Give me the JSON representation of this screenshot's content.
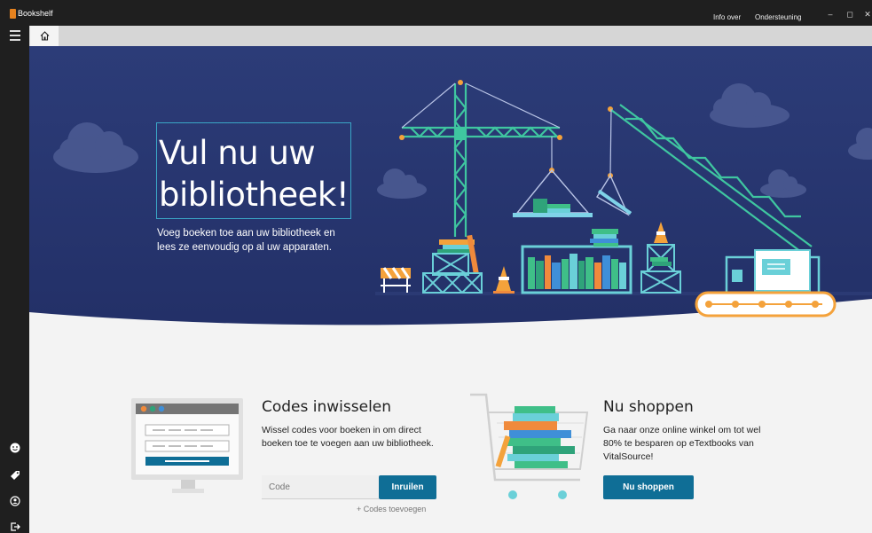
{
  "titlebar": {
    "app_title": "Bookshelf",
    "about": "Info over",
    "support": "Ondersteuning",
    "minimize": "–",
    "maximize": "◻",
    "close": "✕"
  },
  "hero": {
    "title_line1": "Vul nu uw",
    "title_line2": "bibliotheek!",
    "subtitle": "Voeg boeken toe aan uw bibliotheek en lees ze eenvoudig op al uw apparaten."
  },
  "redeem": {
    "title": "Codes inwisselen",
    "text": "Wissel codes voor boeken in om direct boeken toe te voegen aan uw bibliotheek.",
    "input_placeholder": "Code",
    "button": "Inruilen",
    "add_codes": "+ Codes toevoegen"
  },
  "shop": {
    "title": "Nu shoppen",
    "text": "Ga naar onze online winkel om tot wel 80% te besparen op eTextbooks van VitalSource!",
    "button": "Nu shoppen"
  },
  "icons": {
    "rail_menu": "hamburger-icon",
    "home": "home-icon",
    "rail_1": "smiley-icon",
    "rail_2": "tag-icon",
    "rail_3": "account-icon",
    "rail_4": "sign-out-icon"
  },
  "colors": {
    "hero_top": "#2a3a73",
    "hero_bottom": "#22306a",
    "accent_blue": "#0f6e96",
    "crane_green": "#3fc6a0",
    "orange": "#f4a23b",
    "chrome": "#1f1f1f"
  }
}
